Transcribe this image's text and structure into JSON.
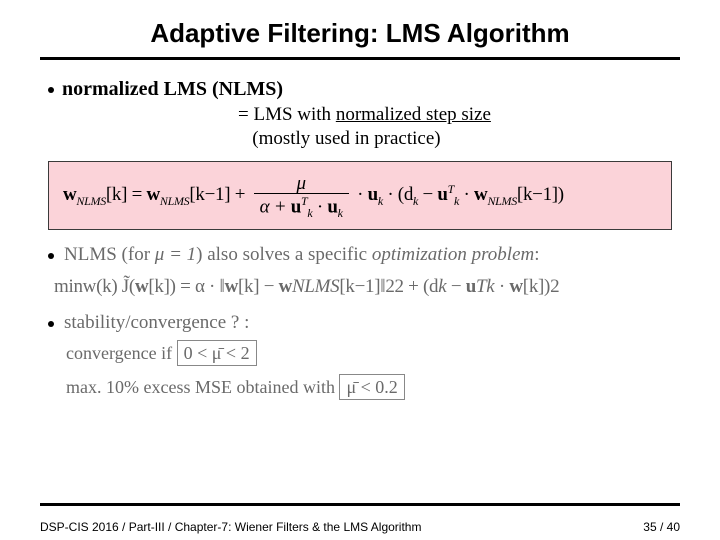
{
  "title": "Adaptive Filtering: LMS Algorithm",
  "line1_label_pre": "normalized LMS (NLMS)",
  "subnote_eq": "= LMS with ",
  "subnote_u": "normalized step size",
  "subnote_paren": "   (mostly used in practice)",
  "formula1": {
    "lhs": "w",
    "sub1": "NLMS",
    "k": "[k] = ",
    "w2": "w",
    "sub2": "NLMS",
    "km1": "[k−1] + ",
    "frac_num": "μ",
    "frac_den_a": "α + ",
    "frac_den_b": "u",
    "frac_den_sup": "T",
    "frac_den_sub": "k",
    "frac_den_dot": " · ",
    "frac_den_c": "u",
    "mid_dot": " · ",
    "uk": "u",
    "uk_sub": "k",
    "mid2": " · (d",
    "dk_sub": "k",
    "minus": " − ",
    "ukT": "u",
    "ukT_sup": "T",
    "ukT_sub": "k",
    "dot3": " · ",
    "w3": "w",
    "sub3": "NLMS",
    "km1b": "[k−1])"
  },
  "bullet2_pre": "NLMS (for ",
  "bullet2_mu": "μ = 1",
  "bullet2_post": ") also solves a specific ",
  "bullet2_it": "optimization problem",
  "bullet2_colon": ":",
  "formula2": {
    "min": "min",
    "minsub": "w(k)",
    "J": " J̃(",
    "wk": "w",
    "kb": "[k]) = α · ",
    "norm_open": "‖",
    "w1": "w",
    "k1": "[k] − ",
    "w2": "w",
    "sub2": "NLMS",
    "km1": "[k−1]",
    "norm_close": "‖",
    "sq": "2",
    "sub2b": "2",
    "plus": " + (d",
    "dk_sub": "k",
    "minus": " − ",
    "uk": "u",
    "uk_sup": "T",
    "uk_sub": "k",
    "dot": " · ",
    "w3": "w",
    "k3": "[k])",
    "sq2": "2"
  },
  "bullet3": "stability/convergence ? :",
  "conv_line_a": "convergence if  ",
  "conv_box": "0 < μ̄ < 2",
  "excess_line_a": "max. 10% excess MSE obtained with  ",
  "excess_box": "μ̄ < 0.2",
  "footer_left": "DSP-CIS 2016  /  Part-III /  Chapter-7: Wiener Filters & the LMS Algorithm",
  "footer_right_a": "35",
  "footer_right_sep": " / ",
  "footer_right_b": "40"
}
